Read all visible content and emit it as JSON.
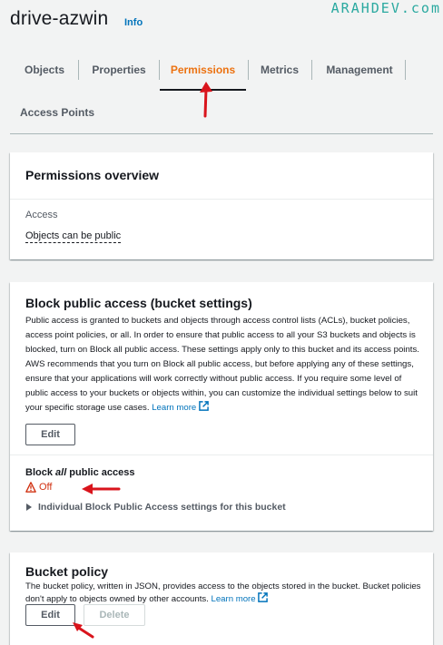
{
  "header": {
    "bucket_name": "drive-azwin",
    "info_label": "Info",
    "watermark": "ARAHDEV.com"
  },
  "tabs": [
    {
      "label": "Objects",
      "active": false
    },
    {
      "label": "Properties",
      "active": false
    },
    {
      "label": "Permissions",
      "active": true
    },
    {
      "label": "Metrics",
      "active": false
    },
    {
      "label": "Management",
      "active": false
    },
    {
      "label": "Access Points",
      "active": false
    }
  ],
  "overview": {
    "title": "Permissions overview",
    "access_label": "Access",
    "access_value": "Objects can be public"
  },
  "block_public": {
    "title": "Block public access (bucket settings)",
    "description": "Public access is granted to buckets and objects through access control lists (ACLs), bucket policies, access point policies, or all. In order to ensure that public access to all your S3 buckets and objects is blocked, turn on Block all public access. These settings apply only to this bucket and its access points. AWS recommends that you turn on Block all public access, but before applying any of these settings, ensure that your applications will work correctly without public access. If you require some level of public access to your buckets or objects within, you can customize the individual settings below to suit your specific storage use cases.",
    "learn_more": "Learn more",
    "edit_label": "Edit",
    "block_all_prefix": "Block ",
    "block_all_emphasis": "all",
    "block_all_suffix": " public access",
    "status": "Off",
    "expander": "Individual Block Public Access settings for this bucket"
  },
  "bucket_policy": {
    "title": "Bucket policy",
    "description": "The bucket policy, written in JSON, provides access to the objects stored in the bucket. Bucket policies don't apply to objects owned by other accounts.",
    "learn_more": "Learn more",
    "edit_label": "Edit",
    "delete_label": "Delete"
  },
  "colors": {
    "accent": "#ec7211",
    "link": "#0073bb",
    "warning": "#d13212",
    "annotation_arrow": "#d9141c",
    "watermark": "#2aa9a0"
  }
}
